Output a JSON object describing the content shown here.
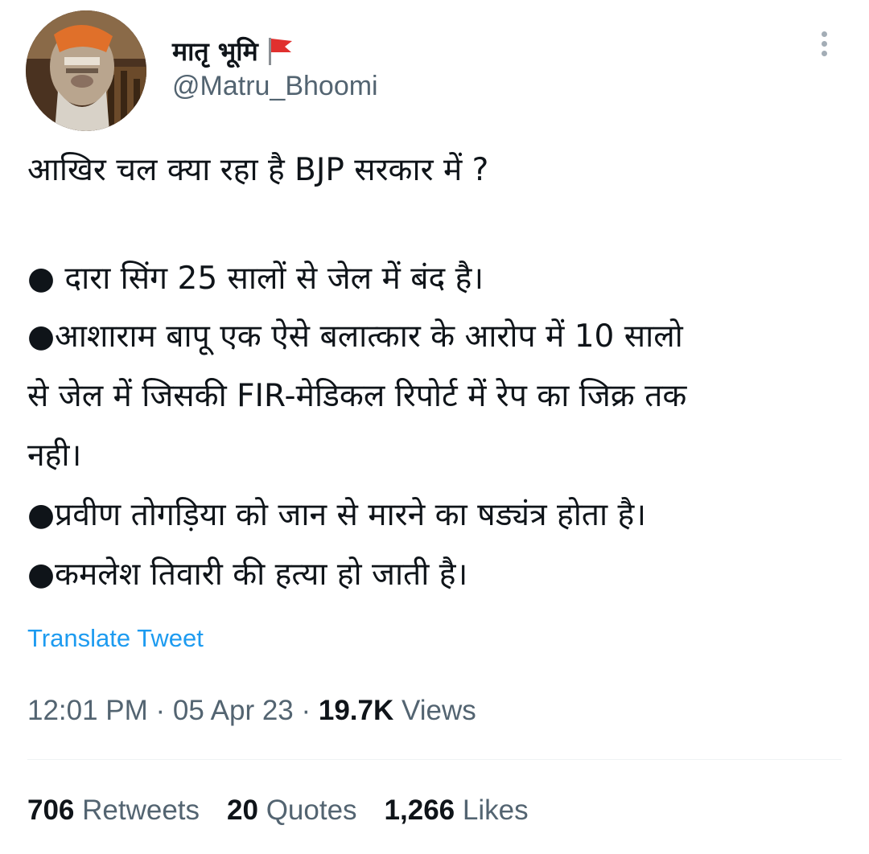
{
  "author": {
    "display_name": "मातृ भूमि",
    "flag_icon": "red-flag-icon",
    "handle": "@Matru_Bhoomi"
  },
  "tweet": {
    "lines": [
      "आखिर चल क्या रहा है BJP सरकार में ?",
      "● दारा सिंग 25 सालों से जेल में बंद है।",
      "●आशाराम बापू एक ऐसे बलात्कार के आरोप में 10 सालो",
      "से जेल में जिसकी FIR-मेडिकल रिपोर्ट में रेप का जिक्र तक",
      "नही।",
      "●प्रवीण तोगड़िया को जान से मारने का षड्यंत्र होता है।",
      "●कमलेश तिवारी की हत्या हो जाती है।"
    ]
  },
  "translate_label": "Translate Tweet",
  "meta": {
    "time": "12:01 PM",
    "separator": " · ",
    "date": "05 Apr 23",
    "views_count": "19.7K",
    "views_label": " Views"
  },
  "stats": {
    "retweets_count": "706",
    "retweets_label": " Retweets",
    "quotes_count": "20",
    "quotes_label": " Quotes",
    "likes_count": "1,266",
    "likes_label": " Likes"
  },
  "colors": {
    "link": "#1d9bf0",
    "secondary_text": "#536471",
    "primary_text": "#0f1419",
    "flag": "#e0302e"
  }
}
